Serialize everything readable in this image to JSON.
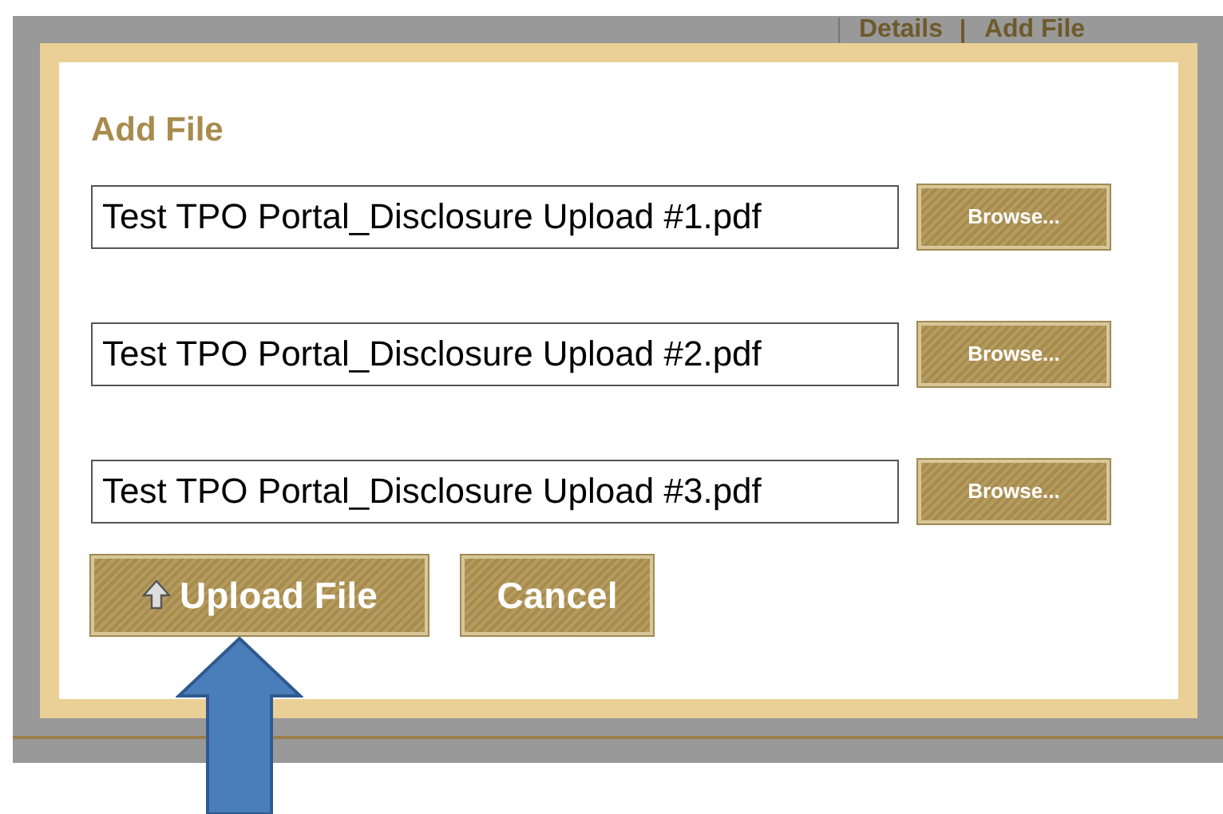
{
  "background_links": [
    "Details",
    "Add File"
  ],
  "dialog": {
    "title": "Add File",
    "files": [
      {
        "value": "Test TPO Portal_Disclosure Upload #1.pdf",
        "browse": "Browse..."
      },
      {
        "value": "Test TPO Portal_Disclosure Upload #2.pdf",
        "browse": "Browse..."
      },
      {
        "value": "Test TPO Portal_Disclosure Upload #3.pdf",
        "browse": "Browse..."
      }
    ],
    "buttons": [
      {
        "kind": "upload",
        "label": "Upload File"
      },
      {
        "kind": "cancel",
        "label": "Cancel"
      }
    ]
  }
}
